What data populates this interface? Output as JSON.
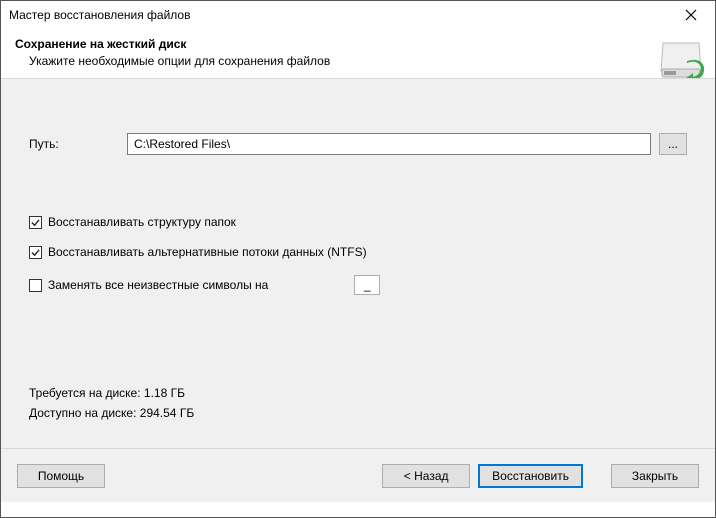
{
  "window": {
    "title": "Мастер восстановления файлов"
  },
  "header": {
    "title": "Сохранение на жесткий диск",
    "subtitle": "Укажите необходимые опции для сохранения файлов"
  },
  "path": {
    "label": "Путь:",
    "value": "C:\\Restored Files\\",
    "browse": "..."
  },
  "options": {
    "restore_structure": {
      "label": "Восстанавливать структуру папок",
      "checked": true
    },
    "restore_ads": {
      "label": "Восстанавливать альтернативные потоки данных (NTFS)",
      "checked": true
    },
    "replace_unknown": {
      "label": "Заменять все неизвестные символы на",
      "checked": false,
      "value": "_"
    }
  },
  "disk": {
    "required_label": "Требуется на диске:",
    "required_value": "1.18 ГБ",
    "available_label": "Доступно на диске:",
    "available_value": "294.54 ГБ"
  },
  "footer": {
    "help": "Помощь",
    "back": "< Назад",
    "restore": "Восстановить",
    "close": "Закрыть"
  }
}
